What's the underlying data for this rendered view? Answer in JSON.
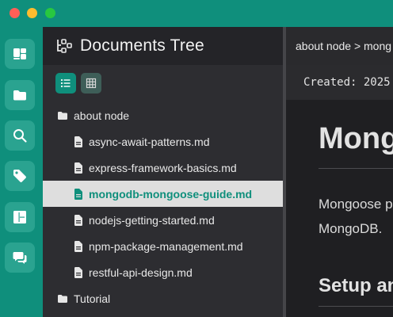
{
  "app": {
    "sidebar_title": "Documents Tree"
  },
  "rail": {
    "items": [
      {
        "icon": "dashboard-icon"
      },
      {
        "icon": "folder-icon"
      },
      {
        "icon": "search-icon"
      },
      {
        "icon": "tag-icon"
      },
      {
        "icon": "board-icon"
      },
      {
        "icon": "chat-icon"
      }
    ]
  },
  "tree": {
    "folders": [
      {
        "label": "about node"
      },
      {
        "label": "Tutorial"
      }
    ],
    "files": [
      {
        "label": "async-await-patterns.md"
      },
      {
        "label": "express-framework-basics.md"
      },
      {
        "label": "mongodb-mongoose-guide.md",
        "active": true
      },
      {
        "label": "nodejs-getting-started.md"
      },
      {
        "label": "npm-package-management.md"
      },
      {
        "label": "restful-api-design.md"
      }
    ]
  },
  "content": {
    "breadcrumb": "about node > mong",
    "created": "Created: 2025",
    "heading": "MongoDB",
    "paragraph_line1": "Mongoose pr",
    "paragraph_line2": "MongoDB.",
    "subheading": "Setup an"
  },
  "colors": {
    "accent": "#0f8f7c",
    "sidebar_bg": "#2d2d31",
    "content_bg": "#1f1f22",
    "active_row_bg": "#dedede"
  }
}
